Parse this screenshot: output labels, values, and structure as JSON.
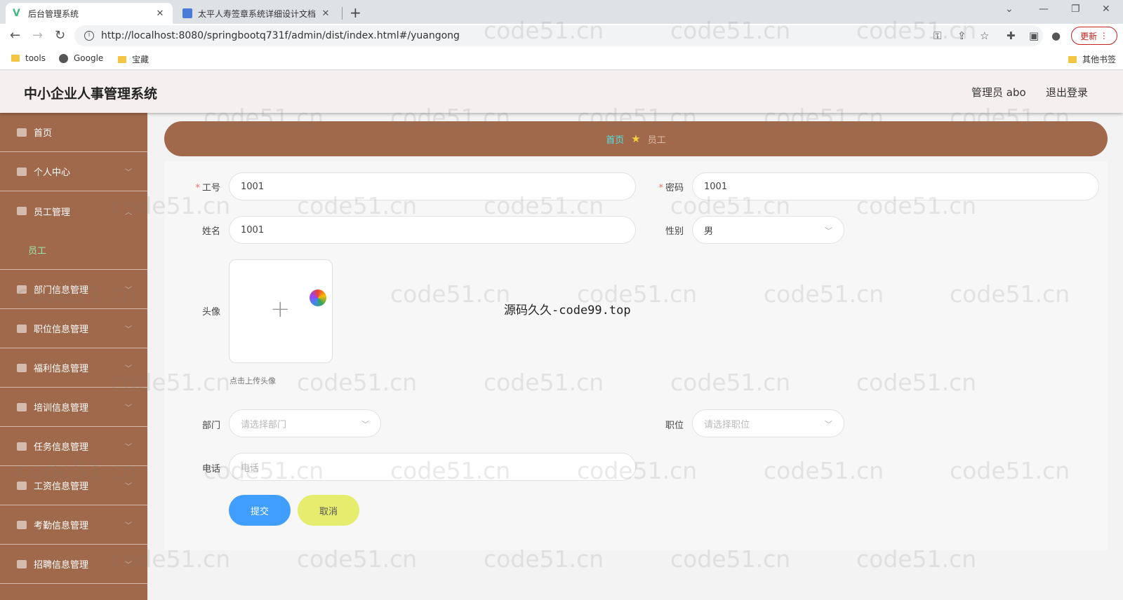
{
  "browser": {
    "tabs": [
      {
        "title": "后台管理系统",
        "active": true
      },
      {
        "title": "太平人寿签章系统详细设计文档",
        "active": false
      }
    ],
    "url": "http://localhost:8080/springbootq731f/admin/dist/index.html#/yuangong",
    "update_label": "更新",
    "bookmarks": [
      "tools",
      "Google",
      "宝藏"
    ],
    "other_bookmarks": "其他书签"
  },
  "header": {
    "title": "中小企业人事管理系统",
    "user": "管理员 abo",
    "logout": "退出登录"
  },
  "sidebar": {
    "items": [
      {
        "label": "首页"
      },
      {
        "label": "个人中心"
      },
      {
        "label": "员工管理"
      },
      {
        "label": "部门信息管理"
      },
      {
        "label": "职位信息管理"
      },
      {
        "label": "福利信息管理"
      },
      {
        "label": "培训信息管理"
      },
      {
        "label": "任务信息管理"
      },
      {
        "label": "工资信息管理"
      },
      {
        "label": "考勤信息管理"
      },
      {
        "label": "招聘信息管理"
      }
    ],
    "sub_item": "员工"
  },
  "breadcrumb": {
    "home": "首页",
    "current": "员工"
  },
  "form": {
    "gonghao": {
      "label": "工号",
      "value": "1001"
    },
    "mima": {
      "label": "密码",
      "value": "1001"
    },
    "xingming": {
      "label": "姓名",
      "value": "1001"
    },
    "xingbie": {
      "label": "性别",
      "value": "男"
    },
    "touxiang": {
      "label": "头像",
      "hint": "点击上传头像"
    },
    "bumen": {
      "label": "部门",
      "placeholder": "请选择部门"
    },
    "zhiwei": {
      "label": "职位",
      "placeholder": "请选择职位"
    },
    "dianhua": {
      "label": "电话",
      "placeholder": "电话"
    },
    "submit": "提交",
    "cancel": "取消"
  },
  "overlay_text": "源码久久-code99.top",
  "watermark": "code51.cn",
  "colors": {
    "sidebar_bg": "#a1694b",
    "submit_btn": "#409eff",
    "cancel_btn": "#e6ec6e",
    "breadcrumb_home": "#55e0e0"
  }
}
